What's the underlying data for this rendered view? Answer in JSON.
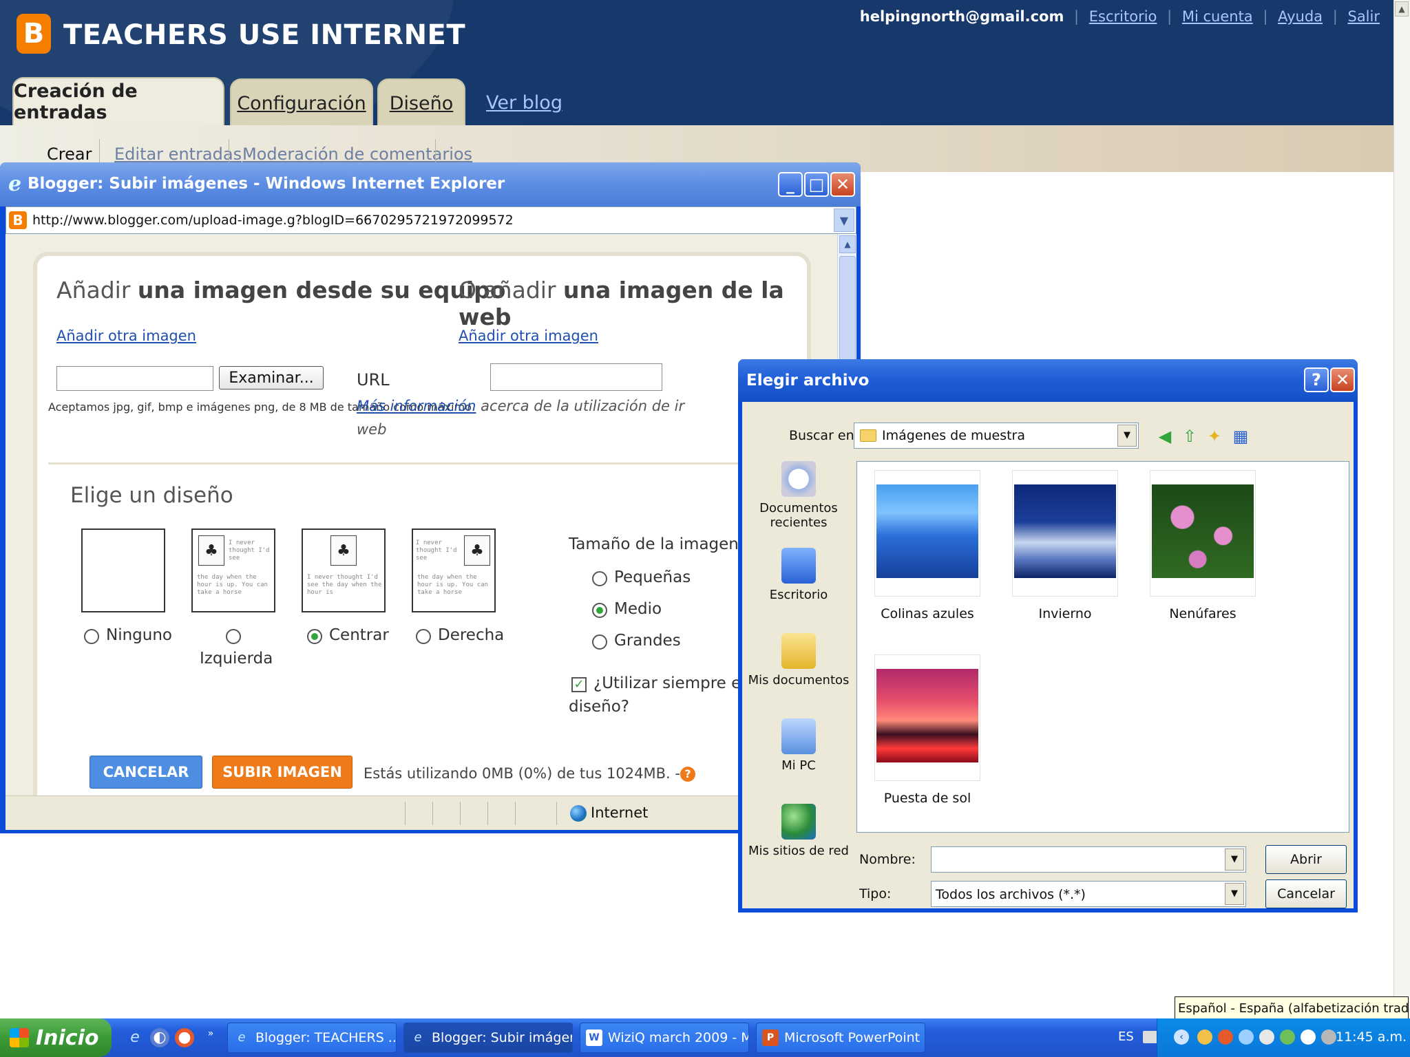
{
  "header": {
    "logo_letter": "B",
    "blog_title": "TEACHERS USE INTERNET",
    "email": "helpingnorth@gmail.com",
    "links": [
      "Escritorio",
      "Mi cuenta",
      "Ayuda",
      "Salir"
    ],
    "tabs": [
      "Creación de entradas",
      "Configuración",
      "Diseño"
    ],
    "view_blog": "Ver blog",
    "subtabs": [
      "Crear",
      "Editar entradas",
      "Moderación de comentarios"
    ]
  },
  "ie_window": {
    "title": "Blogger: Subir imágenes - Windows Internet Explorer",
    "url": "http://www.blogger.com/upload-image.g?blogID=6670295721972099572",
    "status_zone": "Internet"
  },
  "upload": {
    "from_computer": {
      "prefix": "Añadir ",
      "bold": "una imagen desde su equipo"
    },
    "from_web": {
      "prefix": "O añadir ",
      "bold": "una imagen de la web"
    },
    "add_another": "Añadir otra imagen",
    "browse": "Examinar...",
    "accept_note": "Aceptamos jpg, gif, bmp e imágenes png, de 8 MB de tamaño como máximo",
    "url_label": "URL",
    "more_info_link": "Más información",
    "more_info_text": " acerca de la utilización de ir",
    "more_info_text2": "web",
    "layout_title": "Elige un diseño",
    "layouts": [
      {
        "label": "Ninguno",
        "selected": false
      },
      {
        "label": "Izquierda",
        "selected": false
      },
      {
        "label": "Centrar",
        "selected": true
      },
      {
        "label": "Derecha",
        "selected": false
      }
    ],
    "sample_text_left": "I never thought I'd see",
    "sample_text_body": "the day when the hour is up. You can take a horse",
    "sample_text_center": "I never thought I'd see the day when the hour is",
    "size_title": "Tamaño de la imagen:",
    "sizes": [
      {
        "label": "Pequeñas",
        "selected": false
      },
      {
        "label": "Medio",
        "selected": true
      },
      {
        "label": "Grandes",
        "selected": false
      }
    ],
    "always_use": "¿Utilizar siempre este",
    "always_use_2": "diseño?",
    "cancel": "CANCELAR",
    "submit": "SUBIR IMAGEN",
    "quota": "Estás utilizando 0MB (0%) de tus 1024MB. -"
  },
  "file_dialog": {
    "title": "Elegir archivo",
    "look_in_label": "Buscar en:",
    "look_in_value": "Imágenes de muestra",
    "places": [
      "Documentos recientes",
      "Escritorio",
      "Mis documentos",
      "Mi PC",
      "Mis sitios de red"
    ],
    "files": [
      "Colinas azules",
      "Invierno",
      "Nenúfares",
      "Puesta de sol"
    ],
    "name_label": "Nombre:",
    "name_value": "",
    "type_label": "Tipo:",
    "type_value": "Todos los archivos (*.*)",
    "open": "Abrir",
    "cancel": "Cancelar"
  },
  "taskbar": {
    "start": "Inicio",
    "tasks": [
      "Blogger: TEACHERS ...",
      "Blogger: Subir imágen...",
      "WiziQ march 2009 - M...",
      "Microsoft PowerPoint ..."
    ],
    "lang": "ES",
    "tooltip": "Español - España (alfabetización tradicional)",
    "clock": "11:45 a.m."
  }
}
